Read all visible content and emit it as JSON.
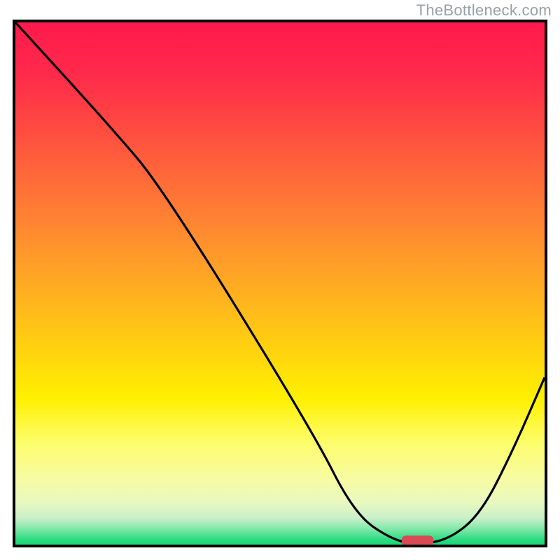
{
  "watermark": "TheBottleneck.com",
  "chart_data": {
    "type": "line",
    "title": "",
    "xlabel": "",
    "ylabel": "",
    "xlim": [
      0,
      100
    ],
    "ylim": [
      0,
      100
    ],
    "grid": false,
    "series": [
      {
        "name": "bottleneck-curve",
        "x": [
          0,
          18,
          28,
          56,
          64,
          71,
          76,
          82,
          88,
          94,
          100
        ],
        "values": [
          100,
          80,
          68,
          22,
          6,
          1,
          0,
          1,
          6,
          18,
          32
        ]
      }
    ],
    "marker": {
      "x": 76,
      "y": 0,
      "width": 6,
      "height": 2
    },
    "background_gradient": {
      "top": "#ff1a4d",
      "mid": "#fff000",
      "bottom": "#17d876"
    }
  }
}
